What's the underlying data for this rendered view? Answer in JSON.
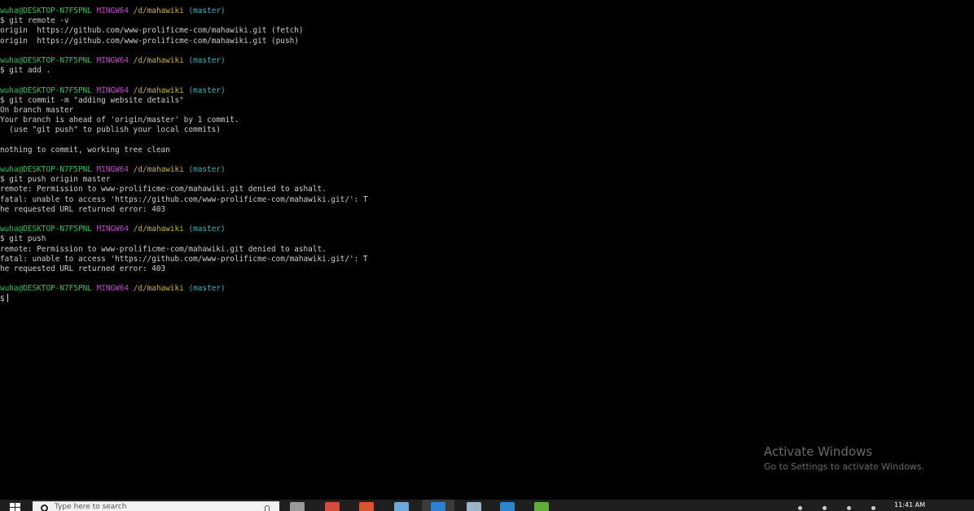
{
  "terminal": {
    "lines": [
      {
        "kind": "prompt",
        "user": "wuha@DESKTOP-N7F5PNL",
        "sys": "MINGW64",
        "path": "/d/mahawiki",
        "branch": "(master)"
      },
      {
        "kind": "text",
        "text": "$ git remote -v"
      },
      {
        "kind": "text",
        "text": "origin  https://github.com/www-prolificme-com/mahawiki.git (fetch)"
      },
      {
        "kind": "text",
        "text": "origin  https://github.com/www-prolificme-com/mahawiki.git (push)"
      },
      {
        "kind": "blank"
      },
      {
        "kind": "prompt",
        "user": "wuha@DESKTOP-N7F5PNL",
        "sys": "MINGW64",
        "path": "/d/mahawiki",
        "branch": "(master)"
      },
      {
        "kind": "text",
        "text": "$ git add ."
      },
      {
        "kind": "blank"
      },
      {
        "kind": "prompt",
        "user": "wuha@DESKTOP-N7F5PNL",
        "sys": "MINGW64",
        "path": "/d/mahawiki",
        "branch": "(master)"
      },
      {
        "kind": "text",
        "text": "$ git commit -m \"adding website details\""
      },
      {
        "kind": "text",
        "text": "On branch master"
      },
      {
        "kind": "text",
        "text": "Your branch is ahead of 'origin/master' by 1 commit."
      },
      {
        "kind": "text",
        "text": "  (use \"git push\" to publish your local commits)"
      },
      {
        "kind": "blank"
      },
      {
        "kind": "text",
        "text": "nothing to commit, working tree clean"
      },
      {
        "kind": "blank"
      },
      {
        "kind": "prompt",
        "user": "wuha@DESKTOP-N7F5PNL",
        "sys": "MINGW64",
        "path": "/d/mahawiki",
        "branch": "(master)"
      },
      {
        "kind": "text",
        "text": "$ git push origin master"
      },
      {
        "kind": "text",
        "text": "remote: Permission to www-prolificme-com/mahawiki.git denied to ashalt."
      },
      {
        "kind": "text",
        "text": "fatal: unable to access 'https://github.com/www-prolificme-com/mahawiki.git/': T"
      },
      {
        "kind": "text",
        "text": "he requested URL returned error: 403"
      },
      {
        "kind": "blank"
      },
      {
        "kind": "prompt",
        "user": "wuha@DESKTOP-N7F5PNL",
        "sys": "MINGW64",
        "path": "/d/mahawiki",
        "branch": "(master)"
      },
      {
        "kind": "text",
        "text": "$ git push"
      },
      {
        "kind": "text",
        "text": "remote: Permission to www-prolificme-com/mahawiki.git denied to ashalt."
      },
      {
        "kind": "text",
        "text": "fatal: unable to access 'https://github.com/www-prolificme-com/mahawiki.git/': T"
      },
      {
        "kind": "text",
        "text": "he requested URL returned error: 403"
      },
      {
        "kind": "blank"
      },
      {
        "kind": "prompt",
        "user": "wuha@DESKTOP-N7F5PNL",
        "sys": "MINGW64",
        "path": "/d/mahawiki",
        "branch": "(master)"
      },
      {
        "kind": "input",
        "text": "$"
      }
    ]
  },
  "watermark": {
    "title": "Activate Windows",
    "subtitle": "Go to Settings to activate Windows."
  },
  "taskbar": {
    "search_placeholder": "Type here to search",
    "clock_time": "11:41 AM",
    "icons": [
      {
        "name": "task-view-icon",
        "color": "#9a9a9a"
      },
      {
        "name": "chrome-icon",
        "color": "#d44d3c"
      },
      {
        "name": "office-icon",
        "color": "#d9532c"
      },
      {
        "name": "git-bash-icon",
        "color": "#6ea8d8"
      },
      {
        "name": "edge-icon",
        "color": "#2f7fd1"
      },
      {
        "name": "explorer-icon",
        "color": "#9ab4c8"
      },
      {
        "name": "vscode-icon",
        "color": "#2b87d2"
      },
      {
        "name": "app-green-icon",
        "color": "#5fae3c"
      }
    ]
  }
}
